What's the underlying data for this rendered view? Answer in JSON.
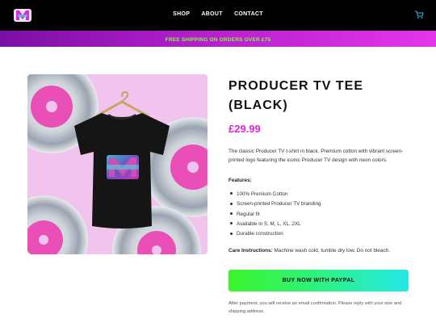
{
  "header": {
    "logo_icon": "producer-tv-logo-icon",
    "nav": [
      "SHOP",
      "ABOUT",
      "CONTACT"
    ],
    "cart_icon": "cart-icon"
  },
  "promo": {
    "text": "FREE SHIPPING ON ORDERS OVER £75"
  },
  "product": {
    "image_icon": "product-photo",
    "title_line1": "PRODUCER TV TEE",
    "title_line2": "(BLACK)",
    "price": "£29.99",
    "description": "The classic Producer TV t-shirt in black. Premium cotton with vibrant screen-printed logo featuring the iconic Producer TV design with neon colors.",
    "features_label": "Features:",
    "features": [
      "100% Premium Cotton",
      "Screen-printed Producer TV branding",
      "Regular fit",
      "Available in S, M, L, XL, 2XL",
      "Durable construction"
    ],
    "care_label": "Care Instructions:",
    "care_text": "Machine wash cold, tumble dry low. Do not bleach.",
    "buy_button": "BUY NOW WITH PAYPAL",
    "after_payment": "After payment, you will receive an email confirmation. Please reply with your size and shipping address."
  },
  "colors": {
    "accent_pink": "#e424d6",
    "promo_text": "#7dff3a",
    "button_start": "#3cf52a",
    "button_end": "#25e8e8"
  }
}
